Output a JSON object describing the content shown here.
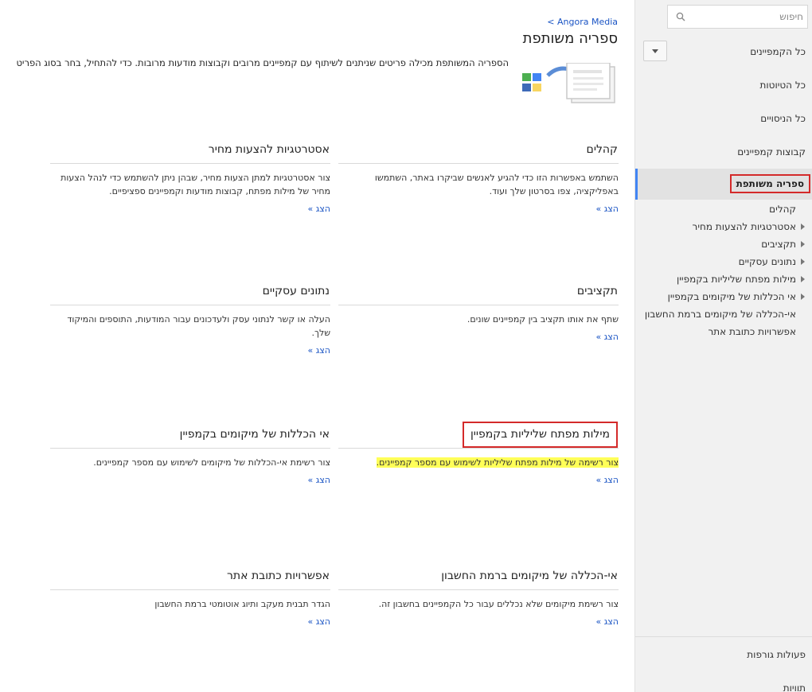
{
  "sidebar": {
    "search_placeholder": "חיפוש",
    "nav_all_campaigns": "כל הקמפיינים",
    "nav_all_drafts": "כל הטיוטות",
    "nav_all_experiments": "כל הניסויים",
    "nav_campaign_groups": "קבוצות קמפיינים",
    "nav_shared_library": "ספריה משותפת",
    "sub_items": [
      "קהלים",
      "אסטרטגיות להצעות מחיר",
      "תקציבים",
      "נתונים עסקיים",
      "מילות מפתח שליליות בקמפיין",
      "אי הכללות של מיקומים בקמפיין",
      "אי-הכללה של מיקומים ברמת החשבון",
      "אפשרויות כתובת אתר"
    ],
    "nav_bulk_operations": "פעולות גורפות",
    "nav_labels": "תוויות"
  },
  "header": {
    "breadcrumb": "< Angora Media",
    "page_title": "ספריה משותפת",
    "description": "הספריה המשותפת מכילה פריטים שניתנים לשיתוף עם קמפיינים מרובים וקבוצות מודעות מרובות. כדי להתחיל, בחר בסוג הפריט"
  },
  "cards": {
    "audiences": {
      "title": "קהלים",
      "description": "השתמש באפשרות הזו כדי להגיע לאנשים שביקרו באתר, השתמשו באפליקציה, צפו בסרטון שלך ועוד.",
      "link": "הצג »"
    },
    "bid_strategies": {
      "title": "אסטרטגיות להצעות מחיר",
      "description": "צור אסטרטגיות למתן הצעות מחיר, שבהן ניתן להשתמש כדי לנהל הצעות מחיר של מילות מפתח, קבוצות מודעות וקמפיינים ספציפיים.",
      "link": "הצג »"
    },
    "budgets": {
      "title": "תקציבים",
      "description": "שתף את אותו תקציב בין קמפיינים שונים.",
      "link": "הצג »"
    },
    "business_data": {
      "title": "נתונים עסקיים",
      "description": "העלה או קשר לנתוני עסק ולעדכונים עבור המודעות, התוספים והמיקוד שלך.",
      "link": "הצג »"
    },
    "negative_keywords": {
      "title": "מילות מפתח שליליות בקמפיין",
      "description": "צור רשימה של מילות מפתח שליליות לשימוש עם מספר קמפיינים.",
      "link": "הצג »"
    },
    "placement_exclusions": {
      "title": "אי הכללות של מיקומים בקמפיין",
      "description": "צור רשימת אי-הכללות של מיקומים לשימוש עם מספר קמפיינים.",
      "link": "הצג »"
    },
    "account_exclusions": {
      "title": "אי-הכללה של מיקומים ברמת החשבון",
      "description": "צור רשימת מיקומים שלא נכללים עבור כל הקמפיינים בחשבון זה.",
      "link": "הצג »"
    },
    "url_options": {
      "title": "אפשרויות כתובת אתר",
      "description": "הגדר תבנית מעקב ותיוג אוטומטי ברמת החשבון",
      "link": "הצג »"
    }
  },
  "colors": {
    "link": "#1a54c4",
    "active_accent": "#4285f4",
    "highlight_box": "#d42a2a",
    "text_highlight": "#ffff58"
  }
}
